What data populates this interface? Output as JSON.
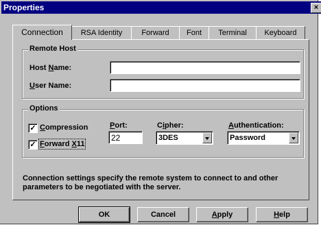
{
  "window": {
    "title": "Properties",
    "close_glyph": "×"
  },
  "tabs": [
    {
      "label": "Connection",
      "active": true
    },
    {
      "label": "RSA Identity"
    },
    {
      "label": "Forward"
    },
    {
      "label": "Font"
    },
    {
      "label": "Terminal"
    },
    {
      "label": "Keyboard"
    }
  ],
  "remote_host": {
    "legend": "Remote Host",
    "host_name_label": "Host Name:",
    "host_name_value": "",
    "user_name_label": "User Name:",
    "user_name_value": ""
  },
  "options": {
    "legend": "Options",
    "compression_label": "Compression",
    "compression_checked": true,
    "forward_x11_label": "Forward X11",
    "forward_x11_checked": true,
    "port_label": "Port:",
    "port_value": "22",
    "cipher_label": "Cipher:",
    "cipher_value": "3DES",
    "auth_label": "Authentication:",
    "auth_value": "Password"
  },
  "description": "Connection settings specify the remote system to connect to and other parameters to be negotiated with the server.",
  "buttons": {
    "ok": "OK",
    "cancel": "Cancel",
    "apply": "Apply",
    "help": "Help"
  }
}
